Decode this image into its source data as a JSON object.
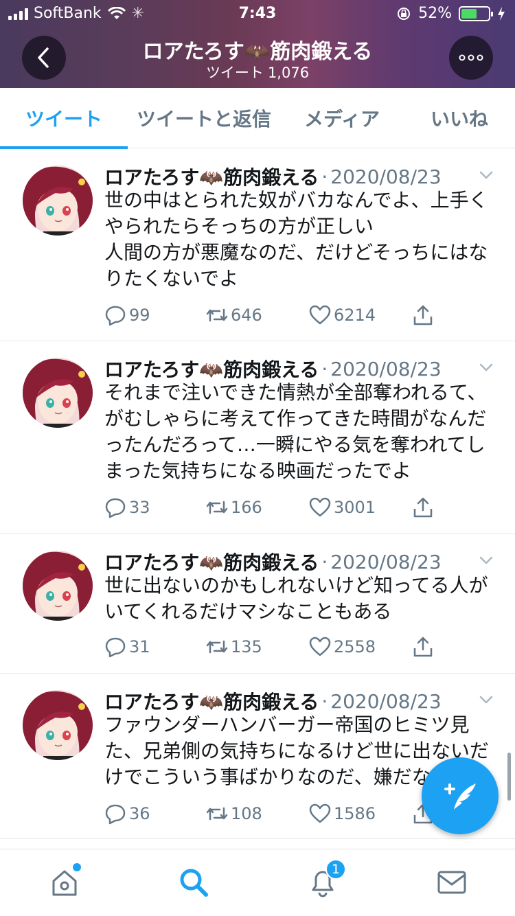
{
  "status_bar": {
    "carrier": "SoftBank",
    "time": "7:43",
    "battery": "52%"
  },
  "header": {
    "title": "ロアたろす🦇筋肉鍛える",
    "subtitle_label": "ツイート",
    "tweet_count": "1,076"
  },
  "tabs": [
    {
      "label": "ツイート",
      "active": true
    },
    {
      "label": "ツイートと返信",
      "active": false
    },
    {
      "label": "メディア",
      "active": false
    },
    {
      "label": "いいね",
      "active": false
    }
  ],
  "tweets": [
    {
      "name": "ロアたろす🦇筋肉鍛える",
      "date": "2020/08/23",
      "lines": [
        "世の中はとられた奴がバカなんでよ、上手く",
        "やられたらそっちの方が正しい",
        "人間の方が悪魔なのだ、だけどそっちにはな",
        "りたくないでよ"
      ],
      "replies": "99",
      "retweets": "646",
      "likes": "6214"
    },
    {
      "name": "ロアたろす🦇筋肉鍛える",
      "date": "2020/08/23",
      "lines": [
        "それまで注いできた情熱が全部奪われるて、",
        "がむしゃらに考えて作ってきた時間がなんだ",
        "ったんだろって…一瞬にやる気を奪われてし",
        "まった気持ちになる映画だったでよ"
      ],
      "replies": "33",
      "retweets": "166",
      "likes": "3001"
    },
    {
      "name": "ロアたろす🦇筋肉鍛える",
      "date": "2020/08/23",
      "lines": [
        "世に出ないのかもしれないけど知ってる人が",
        "いてくれるだけマシなこともある"
      ],
      "replies": "31",
      "retweets": "135",
      "likes": "2558"
    },
    {
      "name": "ロアたろす🦇筋肉鍛える",
      "date": "2020/08/23",
      "lines": [
        "ファウンダーハンバーガー帝国のヒミツ見",
        "た、兄弟側の気持ちになるけど世に出ないだ",
        "けでこういう事ばかりなのだ、嫌だな"
      ],
      "replies": "36",
      "retweets": "108",
      "likes": "1586"
    }
  ],
  "bottom_nav": {
    "notification_badge": "1"
  },
  "colors": {
    "accent": "#1da1f2",
    "secondary_text": "#657786"
  }
}
